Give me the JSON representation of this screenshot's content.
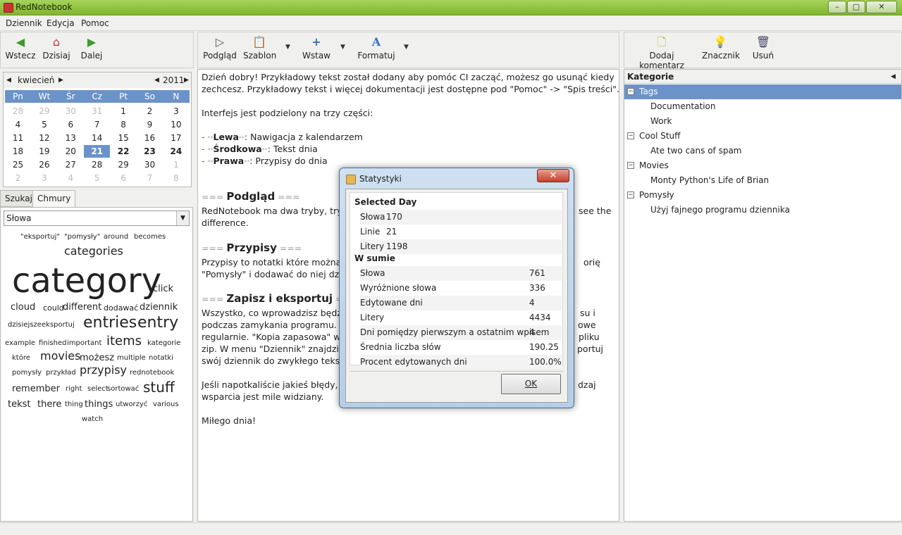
{
  "window": {
    "title": "RedNotebook"
  },
  "menu": {
    "items": [
      "Dziennik",
      "Edycja",
      "Pomoc"
    ]
  },
  "nav_toolbar": {
    "back": "Wstecz",
    "today": "Dzisiaj",
    "forward": "Dalej"
  },
  "edit_toolbar": {
    "preview": "Podgląd",
    "template": "Szablon",
    "insert": "Wstaw",
    "format": "Formatuj"
  },
  "right_toolbar": {
    "add_comment": "Dodaj komentarz",
    "tag": "Znacznik",
    "delete": "Usuń"
  },
  "calendar": {
    "month": "kwiecień",
    "year": "2011",
    "weekdays": [
      "Pn",
      "Wt",
      "Śr",
      "Cz",
      "Pt",
      "So",
      "N"
    ],
    "weeks": [
      [
        "28",
        "29",
        "30",
        "31",
        "1",
        "2",
        "3"
      ],
      [
        "4",
        "5",
        "6",
        "7",
        "8",
        "9",
        "10"
      ],
      [
        "11",
        "12",
        "13",
        "14",
        "15",
        "16",
        "17"
      ],
      [
        "18",
        "19",
        "20",
        "21",
        "22",
        "23",
        "24"
      ],
      [
        "25",
        "26",
        "27",
        "28",
        "29",
        "30",
        "1"
      ],
      [
        "2",
        "3",
        "4",
        "5",
        "6",
        "7",
        "8"
      ]
    ],
    "selected_day": "21",
    "bold_days": [
      "22",
      "23",
      "24"
    ]
  },
  "left_tabs": {
    "search": "Szukaj",
    "clouds": "Chmury"
  },
  "cloud_select": {
    "value": "Słowa"
  },
  "cloud_words": [
    "\"eksportuj\"",
    "\"pomysły\"",
    "around",
    "becomes",
    "categories",
    "category",
    "click",
    "cloud",
    "could",
    "different",
    "dodawać",
    "dziennik",
    "dzisiejsze",
    "eksportuj",
    "entries",
    "entry",
    "example",
    "finished",
    "important",
    "items",
    "kategorie",
    "które",
    "movies",
    "możesz",
    "multiple",
    "notatki",
    "pomysły",
    "przykład",
    "przypisy",
    "rednotebook",
    "remember",
    "right",
    "select",
    "sortować",
    "stuff",
    "tekst",
    "there",
    "thing",
    "things",
    "utworzyć",
    "various",
    "watch"
  ],
  "editor": {
    "lines": {
      "l1": "Dzień dobry! Przykładowy tekst został dodany aby pomóc CI zacząć, możesz go usunąć kiedy",
      "l2": "zechcesz. Przykładowy tekst i więcej dokumentacji jest dostępne pod \"Pomoc\" -> \"Spis treści\".",
      "l3": "Interfejs jest podzielony na trzy części:",
      "b1_bold": "Lewa",
      "b1_rest": ": Nawigacja z kalendarzem",
      "b2_bold": "Środkowa",
      "b2_rest": ": Tekst dnia",
      "b3_bold": "Prawa",
      "b3_rest": ": Przypisy do dnia",
      "h1": "Podgląd",
      "p1a": "RedNotebook ma dwa tryby, tryb",
      "p1a_end": "see the",
      "p1b": "difference.",
      "h2": "Przypisy",
      "p2a": "Przypisy to notatki które można s",
      "p2a_end": "orię",
      "p2b": "\"Pomysły\" i dodawać do niej dzis",
      "h3": "Zapisz i eksportuj",
      "p3a": "Wszystko, co wprowadzisz będzie",
      "p3a_end": "su i",
      "p3b": "podczas zamykania programu. Ab",
      "p3b_end": "owe",
      "p3c": "regularnie. \"Kopia zapasowa\" w m",
      "p3c_end": "pliku",
      "p3d": "zip. W menu \"Dziennik\" znajdziesz",
      "p3d_end": "portuj",
      "p3e": "swój dziennik do zwykłego tekstu,",
      "p4a": "Jeśli napotkaliście jakieś błędy, pr",
      "p4a_end": "dzaj",
      "p4b": "wsparcia jest mile widziany.",
      "p5": "Miłego dnia!"
    }
  },
  "categories": {
    "header": "Kategorie",
    "tree": [
      {
        "label": "Tags",
        "level": 0
      },
      {
        "label": "Documentation",
        "level": 1
      },
      {
        "label": "Work",
        "level": 1
      },
      {
        "label": "Cool Stuff",
        "level": 0
      },
      {
        "label": "Ate two cans of spam",
        "level": 1
      },
      {
        "label": "Movies",
        "level": 0
      },
      {
        "label": "Monty Python's Life of Brian",
        "level": 1
      },
      {
        "label": "Pomysły",
        "level": 0
      },
      {
        "label": "Użyj fajnego programu dziennika",
        "level": 1
      }
    ]
  },
  "stats_dialog": {
    "title": "Statystyki",
    "selected_day_header": "Selected Day",
    "selected_day": [
      {
        "label": "Słowa",
        "value": "170"
      },
      {
        "label": "Linie",
        "value": "21"
      },
      {
        "label": "Litery",
        "value": "1198"
      }
    ],
    "total_header": "W sumie",
    "total": [
      {
        "label": "Słowa",
        "value": "761"
      },
      {
        "label": "Wyróżnione słowa",
        "value": "336"
      },
      {
        "label": "Edytowane dni",
        "value": "4"
      },
      {
        "label": "Litery",
        "value": "4434"
      },
      {
        "label": "Dni pomiędzy pierwszym a ostatnim wpisem",
        "value": "4"
      },
      {
        "label": "Średnia liczba słów",
        "value": "190.25"
      },
      {
        "label": "Procent edytowanych dni",
        "value": "100.0%"
      }
    ],
    "ok": "OK"
  }
}
